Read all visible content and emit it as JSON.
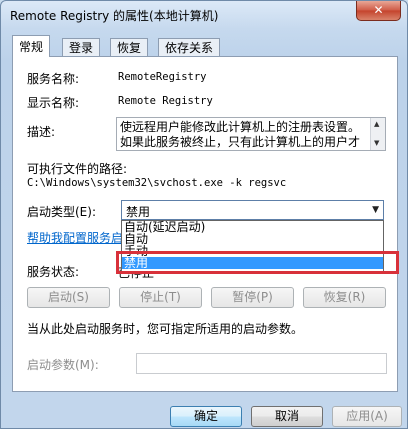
{
  "window": {
    "title": "Remote Registry 的属性(本地计算机)",
    "close_glyph": "✕"
  },
  "tabs": [
    {
      "label": "常规"
    },
    {
      "label": "登录"
    },
    {
      "label": "恢复"
    },
    {
      "label": "依存关系"
    }
  ],
  "general": {
    "service_name_label": "服务名称:",
    "service_name_value": "RemoteRegistry",
    "display_name_label": "显示名称:",
    "display_name_value": "Remote Registry",
    "description_label": "描述:",
    "description_text": "使远程用户能修改此计算机上的注册表设置。如果此服务被终止，只有此计算机上的用户才",
    "exe_path_label": "可执行文件的路径:",
    "exe_path_value": "C:\\Windows\\system32\\svchost.exe -k regsvc",
    "startup_type_label": "启动类型(E):",
    "startup_type_value": "禁用",
    "startup_options": [
      "自动(延迟启动)",
      "自动",
      "手动",
      "禁用"
    ],
    "help_link": "帮助我配置服务启",
    "service_status_label": "服务状态:",
    "service_status_value": "已停止",
    "buttons": {
      "start": "启动(S)",
      "stop": "停止(T)",
      "pause": "暂停(P)",
      "resume": "恢复(R)"
    },
    "start_hint": "当从此处启动服务时，您可指定所适用的启动参数。",
    "start_params_label": "启动参数(M):",
    "start_params_value": ""
  },
  "footer": {
    "ok": "确定",
    "cancel": "取消",
    "apply": "应用(A)"
  }
}
